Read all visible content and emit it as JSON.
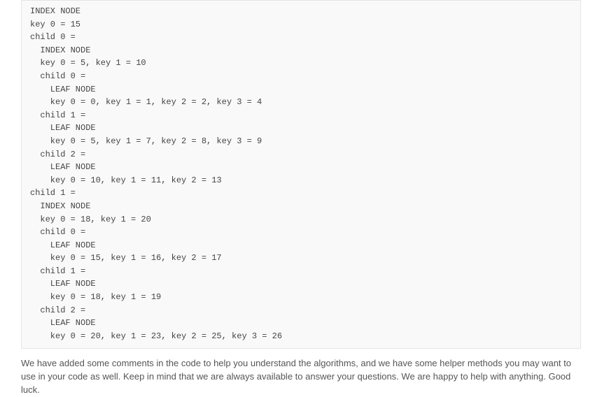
{
  "code_lines": [
    {
      "indent": 1,
      "text": "INDEX NODE"
    },
    {
      "indent": 1,
      "text": "key 0 = 15"
    },
    {
      "indent": 1,
      "text": "child 0 ="
    },
    {
      "indent": 2,
      "text": "INDEX NODE"
    },
    {
      "indent": 2,
      "text": "key 0 = 5, key 1 = 10"
    },
    {
      "indent": 2,
      "text": "child 0 ="
    },
    {
      "indent": 3,
      "text": "LEAF NODE"
    },
    {
      "indent": 3,
      "text": "key 0 = 0, key 1 = 1, key 2 = 2, key 3 = 4"
    },
    {
      "indent": 2,
      "text": "child 1 ="
    },
    {
      "indent": 3,
      "text": "LEAF NODE"
    },
    {
      "indent": 3,
      "text": "key 0 = 5, key 1 = 7, key 2 = 8, key 3 = 9"
    },
    {
      "indent": 2,
      "text": "child 2 ="
    },
    {
      "indent": 3,
      "text": "LEAF NODE"
    },
    {
      "indent": 3,
      "text": "key 0 = 10, key 1 = 11, key 2 = 13"
    },
    {
      "indent": 1,
      "text": "child 1 ="
    },
    {
      "indent": 2,
      "text": "INDEX NODE"
    },
    {
      "indent": 2,
      "text": "key 0 = 18, key 1 = 20"
    },
    {
      "indent": 2,
      "text": "child 0 ="
    },
    {
      "indent": 3,
      "text": "LEAF NODE"
    },
    {
      "indent": 3,
      "text": "key 0 = 15, key 1 = 16, key 2 = 17"
    },
    {
      "indent": 2,
      "text": "child 1 ="
    },
    {
      "indent": 3,
      "text": "LEAF NODE"
    },
    {
      "indent": 3,
      "text": "key 0 = 18, key 1 = 19"
    },
    {
      "indent": 2,
      "text": "child 2 ="
    },
    {
      "indent": 3,
      "text": "LEAF NODE"
    },
    {
      "indent": 3,
      "text": "key 0 = 20, key 1 = 23, key 2 = 25, key 3 = 26"
    }
  ],
  "paragraph": "We have added some comments in the code to help you understand the algorithms, and we have some helper methods you may want to use in your code as well. Keep in mind that we are always available to answer your questions. We are happy to help with anything. Good luck."
}
